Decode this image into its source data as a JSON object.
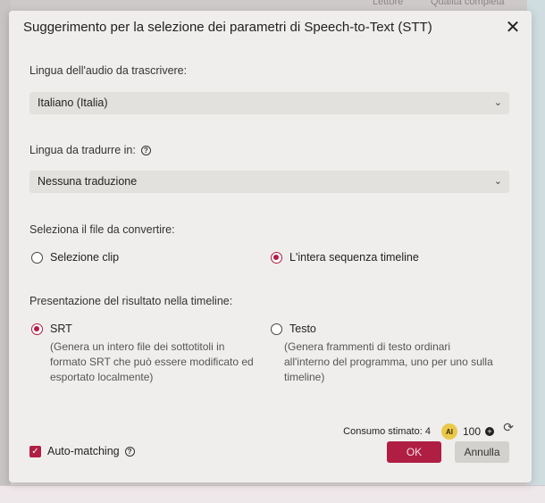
{
  "background": {
    "top_left_text": "Lettore",
    "top_right_text": "Qualità completa"
  },
  "dialog": {
    "title": "Suggerimento per la selezione dei parametri di Speech-to-Text (STT)",
    "close_label": "✕"
  },
  "audio_language": {
    "label": "Lingua dell'audio da trascrivere:",
    "value": "Italiano (Italia)"
  },
  "translate_language": {
    "label": "Lingua da tradurre in:",
    "value": "Nessuna traduzione"
  },
  "file_select": {
    "label": "Seleziona il file da convertire:",
    "options": [
      {
        "label": "Selezione clip",
        "selected": false
      },
      {
        "label": "L'intera sequenza timeline",
        "selected": true
      }
    ]
  },
  "result_format": {
    "label": "Presentazione del risultato nella timeline:",
    "options": [
      {
        "label": "SRT",
        "selected": true,
        "desc": [
          "(Genera un intero file dei sottotitoli in",
          "formato SRT che può essere modificato ed",
          "esportato localmente)"
        ]
      },
      {
        "label": "Testo",
        "selected": false,
        "desc": [
          "(Genera frammenti di testo ordinari",
          "all'interno del programma, uno per uno sulla",
          "timeline)"
        ]
      }
    ]
  },
  "estimate": {
    "label": "Consumo stimato: 4",
    "ai_badge": "AI",
    "credits": "100"
  },
  "auto_matching": {
    "label": "Auto-matching",
    "checked": true
  },
  "buttons": {
    "ok": "OK",
    "cancel": "Annulla"
  },
  "colors": {
    "accent": "#b01e44",
    "dialog_bg": "#efeeec",
    "ai_badge": "#e9c84b"
  }
}
